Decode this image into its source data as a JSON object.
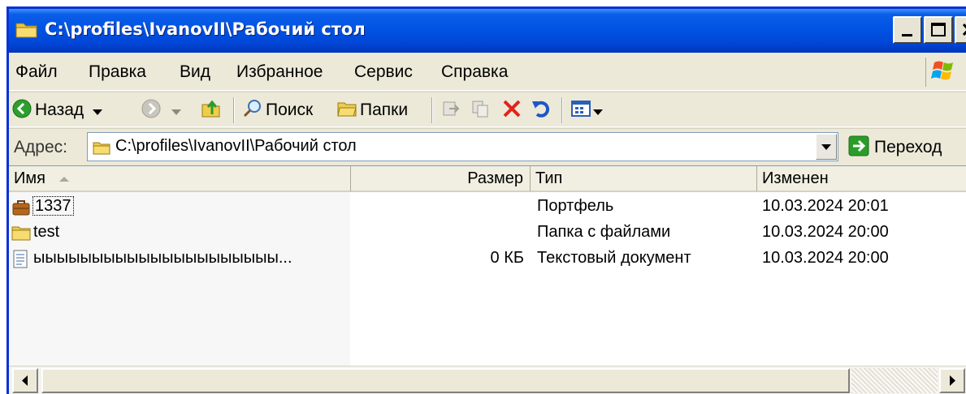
{
  "window": {
    "title": "C:\\profiles\\IvanovII\\Рабочий стол"
  },
  "menu": [
    {
      "label": "Файл"
    },
    {
      "label": "Правка"
    },
    {
      "label": "Вид"
    },
    {
      "label": "Избранное"
    },
    {
      "label": "Сервис"
    },
    {
      "label": "Справка"
    }
  ],
  "toolbar": {
    "back_label": "Назад",
    "search_label": "Поиск",
    "folders_label": "Папки"
  },
  "address": {
    "label": "Адрес:",
    "value": "C:\\profiles\\IvanovII\\Рабочий стол",
    "go_label": "Переход"
  },
  "columns": {
    "name": "Имя",
    "size": "Размер",
    "type": "Тип",
    "modified": "Изменен"
  },
  "files": [
    {
      "name": "1337",
      "size": "",
      "type": "Портфель",
      "modified": "10.03.2024 20:01",
      "icon": "briefcase-icon"
    },
    {
      "name": "test",
      "size": "",
      "type": "Папка с файлами",
      "modified": "10.03.2024 20:00",
      "icon": "folder-icon"
    },
    {
      "name": "ыыыыыыыыыыыыыыыыыыыыы...",
      "size": "0 КБ",
      "type": "Текстовый документ",
      "modified": "10.03.2024 20:00",
      "icon": "text-document-icon"
    }
  ],
  "colors": {
    "titlebar": "#0054e3",
    "close_button": "#e7e4d5",
    "face": "#ece9d8",
    "delete_red": "#e0231c",
    "go_green": "#2a9c2a"
  }
}
